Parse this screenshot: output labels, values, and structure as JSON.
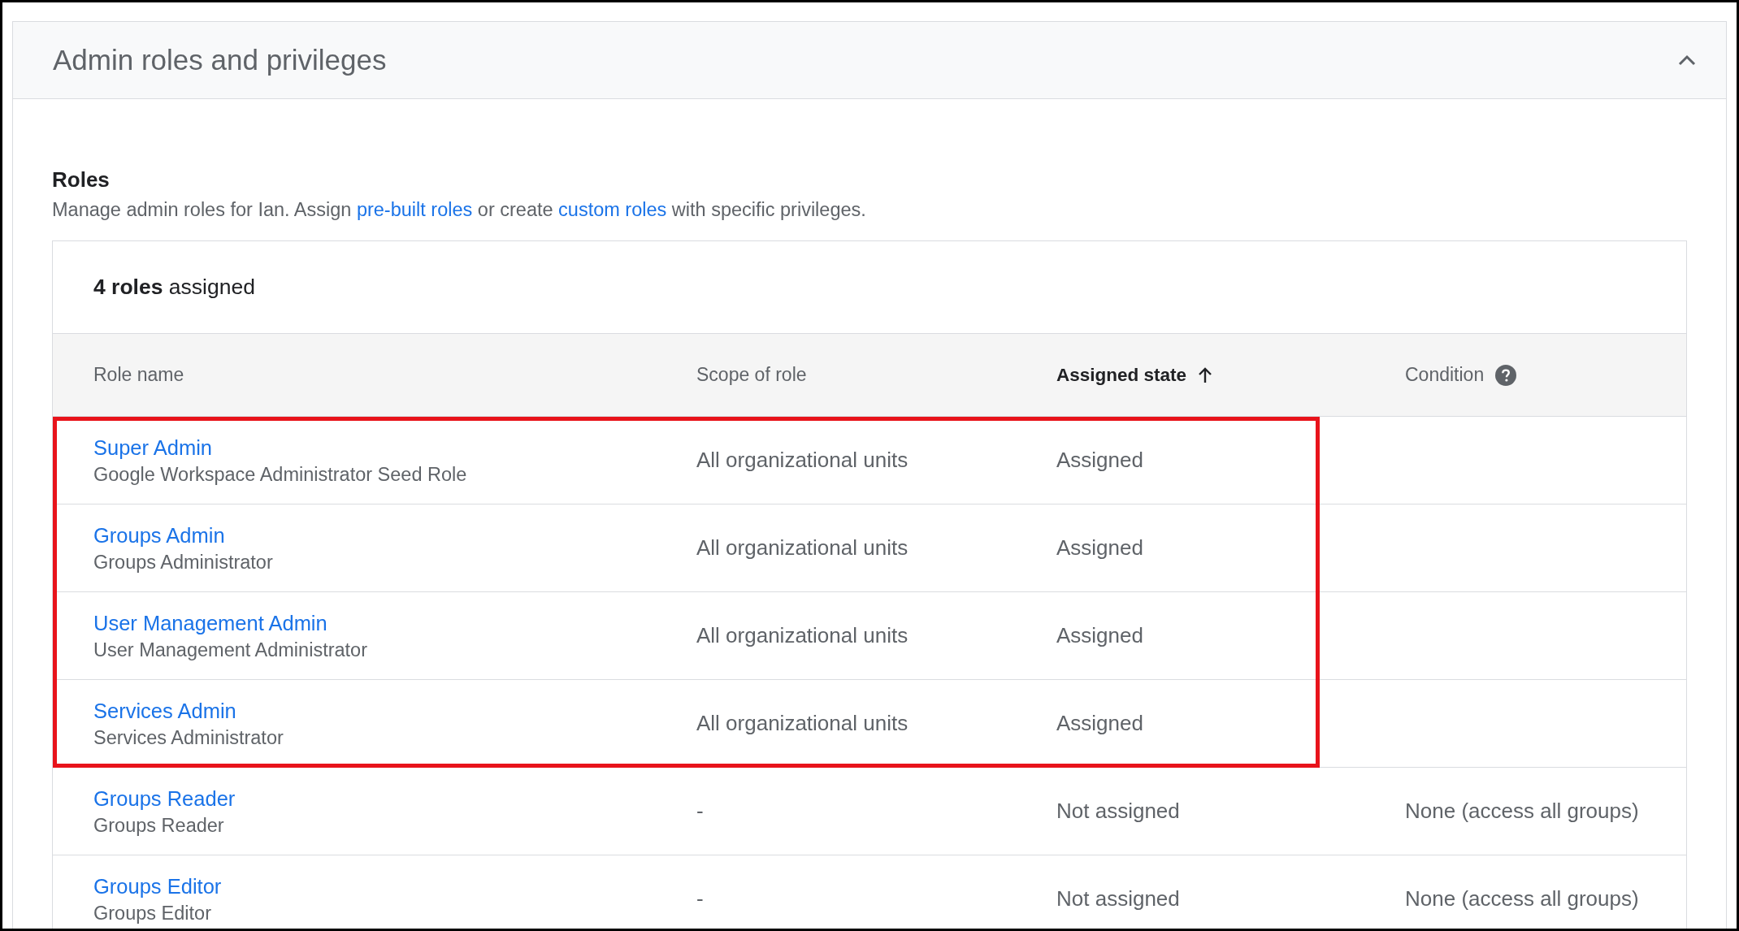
{
  "panel": {
    "title": "Admin roles and privileges",
    "expanded": true
  },
  "roles_section": {
    "heading": "Roles",
    "description_parts": [
      {
        "kind": "text",
        "text": "Manage admin roles for Ian. Assign "
      },
      {
        "kind": "link",
        "text": "pre-built roles"
      },
      {
        "kind": "text",
        "text": " or create "
      },
      {
        "kind": "link",
        "text": "custom roles"
      },
      {
        "kind": "text",
        "text": " with specific privileges."
      }
    ]
  },
  "table": {
    "summary": "**4 roles** assigned",
    "columns": [
      {
        "label": "Role name",
        "sorted": false,
        "help": false
      },
      {
        "label": "Scope of role",
        "sorted": false,
        "help": false
      },
      {
        "label": "Assigned state",
        "sorted": true,
        "help": false
      },
      {
        "label": "Condition",
        "sorted": false,
        "help": true
      }
    ],
    "rows": [
      {
        "role": "Super Admin",
        "description": "Google Workspace Administrator Seed Role",
        "scope": "All organizational units",
        "state": "Assigned",
        "highlighted": true
      },
      {
        "role": "Groups Admin",
        "description": "Groups Administrator",
        "scope": "All organizational units",
        "state": "Assigned",
        "highlighted": true
      },
      {
        "role": "User Management Admin",
        "description": "User Management Administrator",
        "scope": "All organizational units",
        "state": "Assigned",
        "highlighted": true
      },
      {
        "role": "Services Admin",
        "description": "Services Administrator",
        "scope": "All organizational units",
        "state": "Assigned",
        "highlighted": true
      },
      {
        "role": "Groups Reader",
        "description": "Groups Reader",
        "scope": "-",
        "state": "Not assigned",
        "condition": "None (access all groups)",
        "highlighted": false
      },
      {
        "role": "Groups Editor",
        "description": "Groups Editor",
        "scope": "-",
        "state": "Not assigned",
        "condition": "None (access all groups)",
        "highlighted": false
      }
    ]
  }
}
